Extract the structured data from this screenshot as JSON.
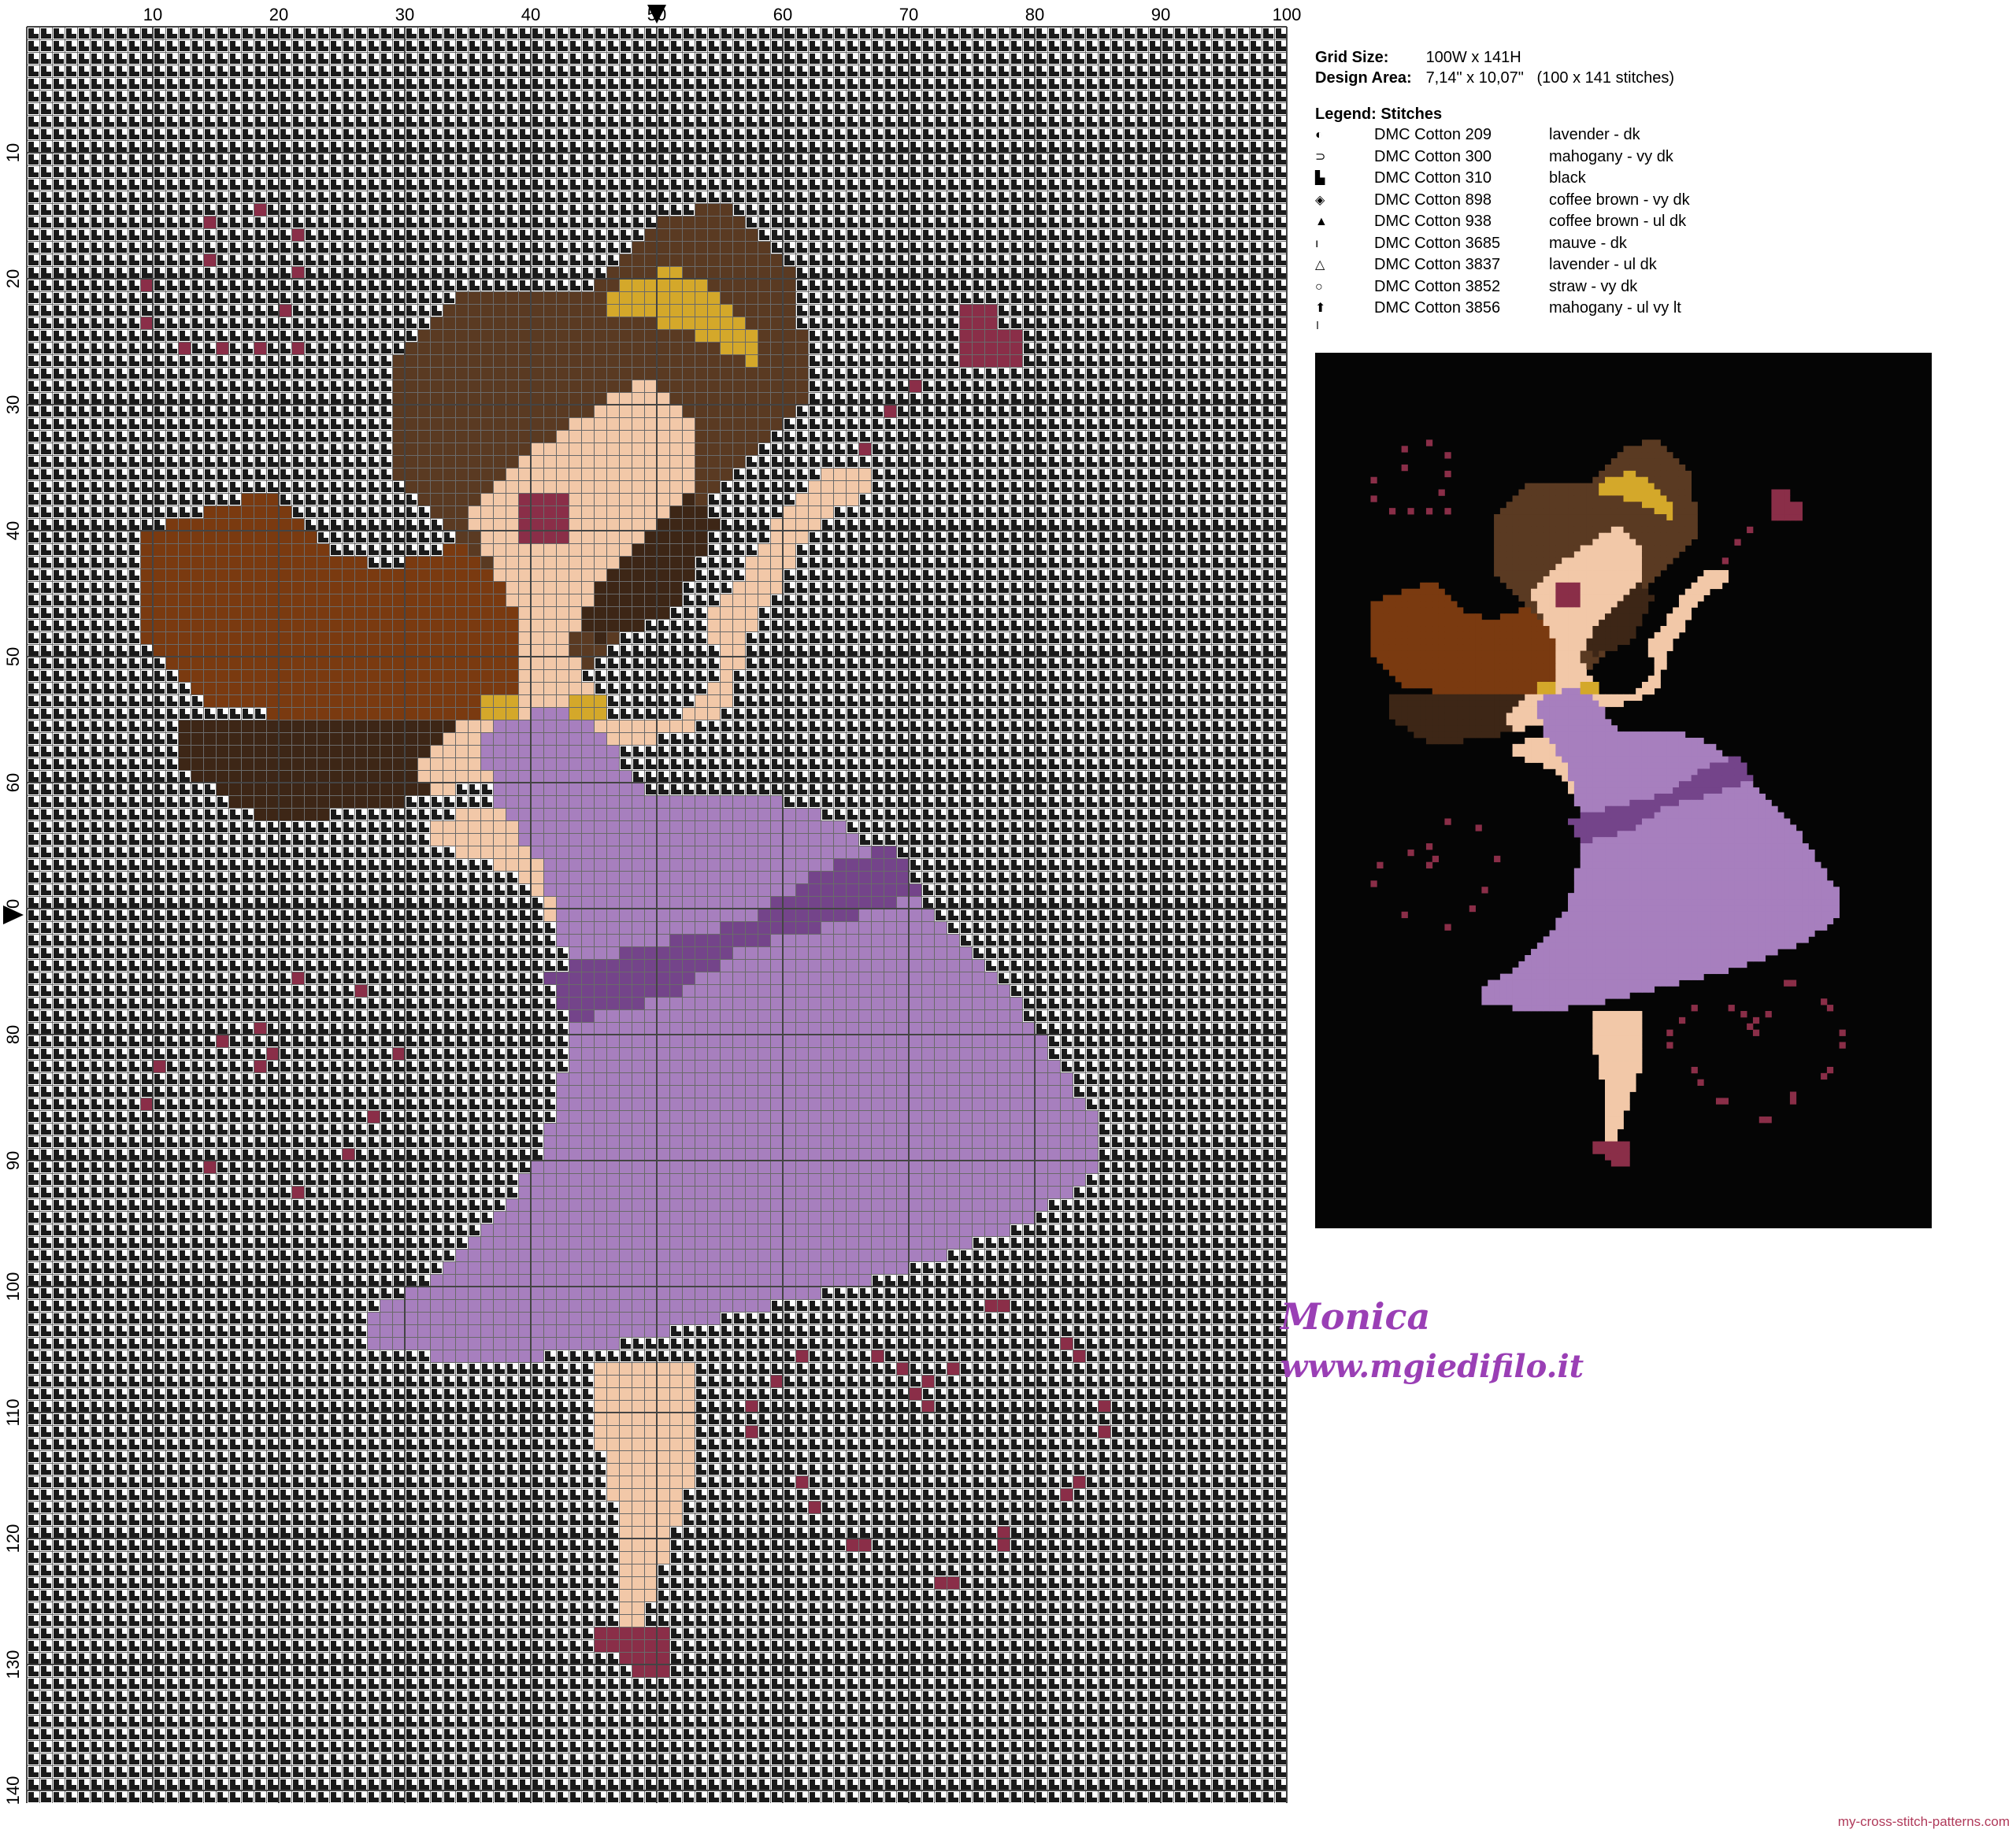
{
  "chart": {
    "x_ticks": [
      "10",
      "20",
      "30",
      "40",
      "50",
      "60",
      "70",
      "80",
      "90",
      "100"
    ],
    "y_ticks": [
      "10",
      "20",
      "30",
      "40",
      "50",
      "60",
      "70",
      "80",
      "90",
      "100",
      "110",
      "120",
      "130",
      "140"
    ],
    "grid_cols": 100,
    "grid_rows": 141
  },
  "info": {
    "grid_size_label": "Grid Size:",
    "grid_size_value": "100W x 141H",
    "design_area_label": "Design Area:",
    "design_area_value": "7,14\" x 10,07\"   (100 x 141 stitches)"
  },
  "legend": {
    "title": "Legend: Stitches",
    "items": [
      {
        "symbol": "◐",
        "code": "DMC Cotton 209",
        "name": "lavender - dk",
        "color": "#a77fbe"
      },
      {
        "symbol": "⊃",
        "code": "DMC Cotton 300",
        "name": "mahogany - vy dk",
        "color": "#7a3a10"
      },
      {
        "symbol": "▙",
        "code": "DMC Cotton 310",
        "name": "black",
        "color": "#000000"
      },
      {
        "symbol": "◈",
        "code": "DMC Cotton 898",
        "name": "coffee brown - vy dk",
        "color": "#5a3a22"
      },
      {
        "symbol": "▲",
        "code": "DMC Cotton 938",
        "name": "coffee brown - ul dk",
        "color": "#3d2616"
      },
      {
        "symbol": "ı",
        "code": "DMC Cotton 3685",
        "name": "mauve - dk",
        "color": "#8a2e48"
      },
      {
        "symbol": "△",
        "code": "DMC Cotton 3837",
        "name": "lavender - ul dk",
        "color": "#74448a"
      },
      {
        "symbol": "○",
        "code": "DMC Cotton 3852",
        "name": "straw - vy dk",
        "color": "#d4a82a"
      },
      {
        "symbol": "⬆",
        "code": "DMC Cotton 3856",
        "name": "mahogany - ul vy lt",
        "color": "#f2c8a8"
      }
    ]
  },
  "signature": {
    "name": "Monica",
    "url": "www.mgiedifilo.it"
  },
  "footer": "my-cross-stitch-patterns.com"
}
